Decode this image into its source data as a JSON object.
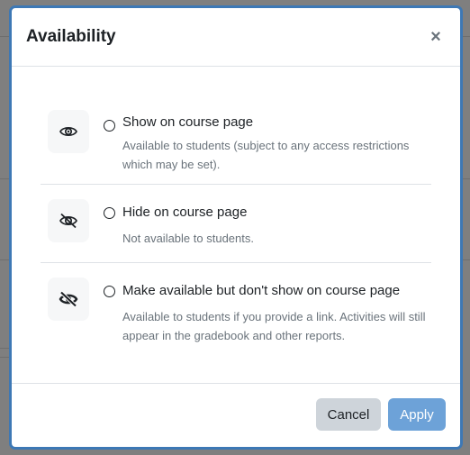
{
  "modal": {
    "title": "Availability",
    "close_symbol": "×",
    "accent_color": "#3d78b5"
  },
  "options": [
    {
      "label": "Show on course page",
      "description": "Available to students (subject to any access restrictions which may be set).",
      "icon": "eye-icon",
      "selected": false
    },
    {
      "label": "Hide on course page",
      "description": "Not available to students.",
      "icon": "eye-slash-icon",
      "selected": false
    },
    {
      "label": "Make available but don't show on course page",
      "description": "Available to students if you provide a link. Activities will still appear in the gradebook and other reports.",
      "icon": "eye-slash-bold-icon",
      "selected": false
    }
  ],
  "footer": {
    "cancel_label": "Cancel",
    "apply_label": "Apply"
  }
}
